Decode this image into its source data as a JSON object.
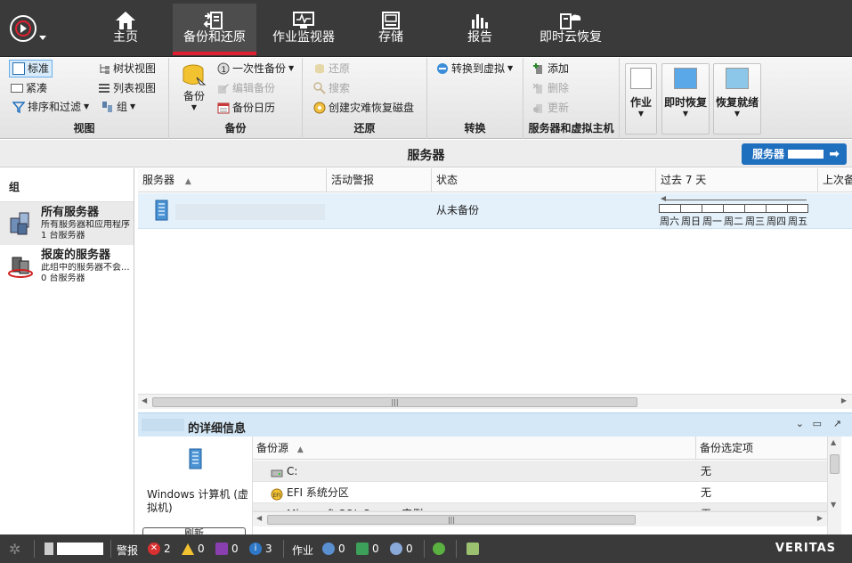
{
  "nav": {
    "tabs": [
      {
        "label": "主页",
        "icon": "home-icon"
      },
      {
        "label": "备份和还原",
        "icon": "backup-restore-icon"
      },
      {
        "label": "作业监视器",
        "icon": "job-monitor-icon"
      },
      {
        "label": "存储",
        "icon": "storage-icon"
      },
      {
        "label": "报告",
        "icon": "reports-icon"
      },
      {
        "label": "即时云恢复",
        "icon": "cloud-recovery-icon"
      }
    ],
    "active_tab": "备份和还原"
  },
  "ribbon": {
    "view": {
      "title": "视图",
      "standard": "标准",
      "compact": "紧凑",
      "sort_filter": "排序和过滤",
      "tree_view": "树状视图",
      "list_view": "列表视图",
      "group": "组"
    },
    "backup": {
      "title": "备份",
      "backup": "备份",
      "one_time": "一次性备份",
      "edit": "编辑备份",
      "calendar": "备份日历"
    },
    "restore": {
      "title": "还原",
      "restore": "还原",
      "search": "搜索",
      "create_disk": "创建灾难恢复磁盘"
    },
    "convert": {
      "title": "转换",
      "to_virtual": "转换到虚拟"
    },
    "servers": {
      "title": "服务器和虚拟主机",
      "add": "添加",
      "delete": "删除",
      "update": "更新"
    },
    "big": {
      "jobs": "作业",
      "instant_recovery": "即时恢复",
      "recovery_ready": "恢复就绪"
    }
  },
  "titlebar": {
    "title": "服务器",
    "button": "服务器"
  },
  "groups": {
    "header": "组",
    "items": [
      {
        "name": "所有服务器",
        "desc": "所有服务器和应用程序",
        "count": "1 台服务器"
      },
      {
        "name": "报废的服务器",
        "desc": "此组中的服务器不会...",
        "count": "0 台服务器"
      }
    ]
  },
  "list": {
    "columns": [
      "服务器",
      "活动警报",
      "状态",
      "过去 7 天",
      "上次备"
    ],
    "sort_indicator": "▲",
    "rows": [
      {
        "status": "从未备份"
      }
    ],
    "week_days": [
      "周六",
      "周日",
      "周一",
      "周二",
      "周三",
      "周四",
      "周五"
    ]
  },
  "details": {
    "title": "的详细信息",
    "machine": "Windows 计算机 (虚拟机)",
    "refresh": "刷新",
    "columns": [
      "备份源",
      "备份选定项"
    ],
    "rows": [
      {
        "source": "C:",
        "selection": "无"
      },
      {
        "source": "EFI 系统分区",
        "selection": "无"
      },
      {
        "source": "Microsoft SQL Server 实例",
        "selection": "无"
      }
    ]
  },
  "statusbar": {
    "alerts_label": "警报",
    "errors": "2",
    "warnings": "0",
    "attention": "0",
    "info": "3",
    "jobs_label": "作业",
    "jobs_a": "0",
    "jobs_b": "0",
    "jobs_c": "0",
    "brand": "VERITAS"
  },
  "colors": {
    "nav_bg": "#3a3a3a",
    "accent_red": "#e02030",
    "button_blue": "#1f6fbf",
    "selected_row": "#e4f1fb"
  }
}
